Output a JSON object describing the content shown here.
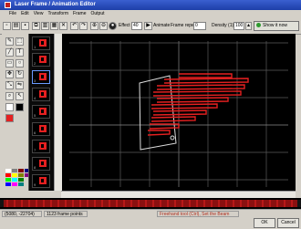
{
  "window": {
    "title": "Laser Frame / Animation Editor"
  },
  "menu": [
    "File",
    "Edit",
    "View",
    "Transform",
    "Frame",
    "Output"
  ],
  "toolbar": {
    "effect_label": "Effect",
    "frame_value": "40",
    "animate_label": "Animate",
    "frame_repeats_label": "Frame repeats",
    "frame_repeats_value": "0",
    "density_label": "Density (1)",
    "density_value": "100",
    "show_label": "Show it now"
  },
  "colors": {
    "accent": "#1d3ea8",
    "laser_red": "#e52020",
    "grid": "#5a5a5a",
    "outline": "#dddddd"
  },
  "palette": [
    "#ffffff",
    "#808080",
    "#ff0000",
    "#ffff00",
    "#00ff00",
    "#00ffff",
    "#0000ff",
    "#ff00ff",
    "#800000",
    "#808000",
    "#008000",
    "#008080",
    "#000080",
    "#800080"
  ],
  "frames": [
    "1",
    "2",
    "3",
    "4",
    "5",
    "6",
    "7",
    "8",
    "9"
  ],
  "status": {
    "coords": "(5080, -22704)",
    "points": "1123 frame points",
    "hint": "Freehand tool (Ctrl), Set the Beam"
  },
  "buttons": {
    "ok": "OK",
    "cancel": "Cancel"
  }
}
